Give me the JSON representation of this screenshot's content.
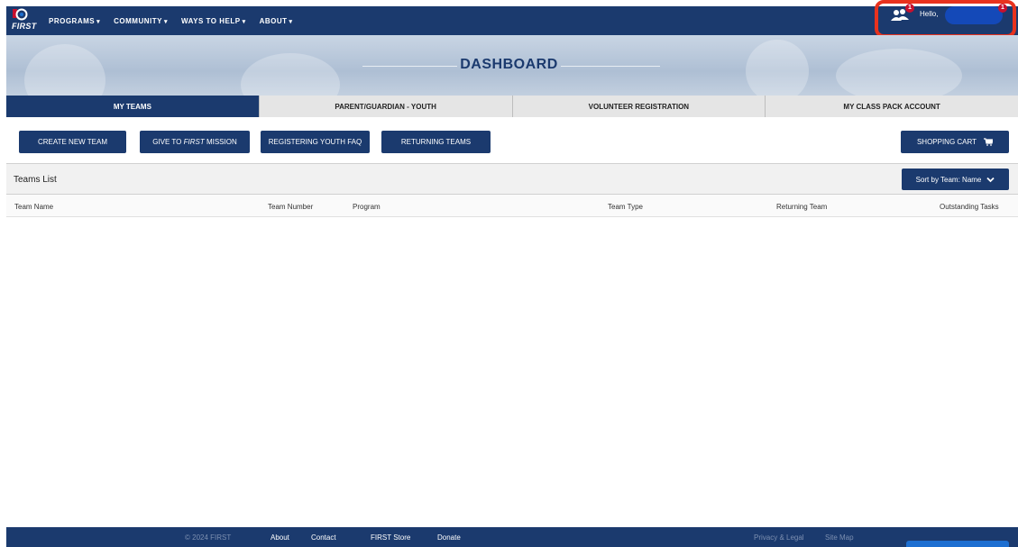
{
  "nav": {
    "logo_text": "FIRST",
    "items": [
      {
        "label": "PROGRAMS"
      },
      {
        "label": "COMMUNITY"
      },
      {
        "label": "WAYS TO HELP"
      },
      {
        "label": "ABOUT"
      }
    ],
    "caret": "▾",
    "user": {
      "badge_team": "1",
      "hello": "Hello,",
      "badge_account": "1"
    }
  },
  "annotation": {
    "number": "1"
  },
  "banner": {
    "title": "DASHBOARD"
  },
  "tabs": [
    {
      "label": "MY TEAMS",
      "active": true
    },
    {
      "label": "PARENT/GUARDIAN - YOUTH",
      "active": false
    },
    {
      "label": "VOLUNTEER REGISTRATION",
      "active": false
    },
    {
      "label": "MY CLASS PACK ACCOUNT",
      "active": false
    }
  ],
  "actions": {
    "create_new_team": "CREATE NEW TEAM",
    "give_to_prefix": "GIVE TO ",
    "give_to_emph": "FIRST",
    "give_to_suffix": " MISSION",
    "registering_youth_faq": "REGISTERING YOUTH FAQ",
    "returning_teams": "RETURNING TEAMS",
    "shopping_cart": "SHOPPING CART"
  },
  "teams_list": {
    "title": "Teams List",
    "sort_label": "Sort by Team: Name",
    "columns": [
      "Team Name",
      "Team Number",
      "Program",
      "Team Type",
      "Returning Team",
      "Outstanding Tasks"
    ],
    "rows": []
  },
  "footer": {
    "copyright": "© 2024 FIRST",
    "links": [
      "About",
      "Contact",
      "FIRST Store",
      "Donate"
    ],
    "legal": [
      "Privacy & Legal",
      "Site Map"
    ]
  },
  "colors": {
    "primary_navy": "#1b3a6e",
    "highlight_red": "#e8321e",
    "badge_red": "#c8102e",
    "name_blue": "#1449b8"
  }
}
